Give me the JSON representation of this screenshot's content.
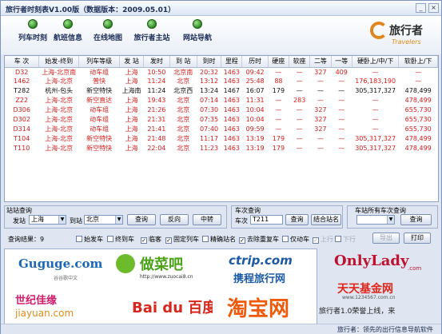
{
  "window": {
    "title": "旅行者时刻表V1.00版（数据版本：2009.05.01）",
    "minimize": "_",
    "close": "×"
  },
  "nav": [
    "列车时刻",
    "航班信息",
    "在线地图",
    "旅行者主站",
    "网站导航"
  ],
  "logo": {
    "name": "旅行者",
    "en": "Travelers"
  },
  "table": {
    "headers": [
      "车  次",
      "始发-终到",
      "列车等级",
      "发  站",
      "发时",
      "到  站",
      "到时",
      "里程",
      "历时",
      "硬座",
      "软座",
      "二等",
      "一等",
      "硬卧上/中/下",
      "软卧上/下"
    ],
    "rows": [
      [
        "D32",
        "上海-北京南",
        "动车组",
        "上海",
        "10:50",
        "北京南",
        "20:32",
        "1463",
        "09:42",
        "—",
        "—",
        "327",
        "409",
        "—",
        "—"
      ],
      [
        "1462",
        "上海-北京",
        "普快",
        "上海",
        "11:24",
        "北京",
        "13:12",
        "1463",
        "25:48",
        "88",
        "—",
        "—",
        "—",
        "176,183,190",
        "—"
      ],
      [
        "T282",
        "杭州-包头",
        "新空特快",
        "上海南",
        "11:24",
        "北京西",
        "13:24",
        "1467",
        "16:07",
        "179",
        "—",
        "—",
        "—",
        "305,317,327",
        "478,499"
      ],
      [
        "Z22",
        "上海-北京",
        "新空直达",
        "上海",
        "19:43",
        "北京",
        "07:14",
        "1463",
        "11:31",
        "—",
        "283",
        "—",
        "—",
        "—",
        "478,499"
      ],
      [
        "D306",
        "上海-北京",
        "动车组",
        "上海",
        "21:26",
        "北京",
        "07:30",
        "1463",
        "10:04",
        "—",
        "—",
        "327",
        "—",
        "—",
        "655,730"
      ],
      [
        "D302",
        "上海-北京",
        "动车组",
        "上海",
        "21:31",
        "北京",
        "07:35",
        "1463",
        "10:04",
        "—",
        "—",
        "327",
        "—",
        "—",
        "655,730"
      ],
      [
        "D314",
        "上海-北京",
        "动车组",
        "上海",
        "21:41",
        "北京",
        "07:40",
        "1463",
        "09:59",
        "—",
        "—",
        "327",
        "—",
        "—",
        "655,730"
      ],
      [
        "T104",
        "上海-北京",
        "新空特快",
        "上海",
        "21:48",
        "北京",
        "11:17",
        "1463",
        "13:19",
        "179",
        "—",
        "—",
        "—",
        "305,317,327",
        "478,499"
      ],
      [
        "T110",
        "上海-北京",
        "新空特快",
        "上海",
        "22:04",
        "北京",
        "11:23",
        "1463",
        "13:19",
        "179",
        "—",
        "—",
        "—",
        "305,317,327",
        "478,499"
      ]
    ]
  },
  "station_query": {
    "title": "站站查询",
    "from_label": "发站",
    "from_value": "上海",
    "to_label": "到站",
    "to_value": "北京",
    "query_btn": "查询",
    "reverse_btn": "反向",
    "transfer_btn": "中转"
  },
  "train_query": {
    "title": "车次查询",
    "label": "车次",
    "value": "T211",
    "query_btn": "查询",
    "combo_btn": "结合站名"
  },
  "station_all": {
    "title": "车站所有车次查询",
    "value": "",
    "query_btn": "查询"
  },
  "results": {
    "label": "查询结果：9",
    "checks": [
      {
        "label": "始发车",
        "checked": false,
        "disabled": false
      },
      {
        "label": "终到车",
        "checked": false,
        "disabled": false
      },
      {
        "label": "临客",
        "checked": true,
        "disabled": false
      },
      {
        "label": "固定列车",
        "checked": true,
        "disabled": false
      },
      {
        "label": "精确站名",
        "checked": false,
        "disabled": false
      },
      {
        "label": "去除重复车",
        "checked": true,
        "disabled": false
      },
      {
        "label": "仅动车",
        "checked": false,
        "disabled": false
      },
      {
        "label": "上行",
        "checked": true,
        "disabled": true
      },
      {
        "label": "下行",
        "checked": false,
        "disabled": true
      }
    ],
    "export_btn": "导出",
    "print_btn": "打印"
  },
  "ads": [
    {
      "main": "Guguge.com",
      "sub": "谷谷歌中文"
    },
    {
      "main": "做菜吧",
      "sub": "http://www.zuocai8.cn"
    },
    {
      "main": "ctrip.com",
      "sub": "携程旅行网"
    },
    {
      "main": "OnlyLady",
      "sub": ".com"
    },
    {
      "main": "世纪佳缘",
      "sub": "jiayuan.com"
    },
    {
      "main": "Bai du 百度",
      "sub": ""
    },
    {
      "main": "淘宝网",
      "sub": ""
    },
    {
      "main": "天天基金网",
      "sub": "www.1234567.com.cn"
    }
  ],
  "status": "旅行者1.0荣誉上线，来",
  "footer": "旅行者：领先的出行信息导航软件",
  "colors": {
    "accent": "#d61c1c",
    "nav_ball": "#2e8a1f",
    "logo": "#e0871b"
  }
}
